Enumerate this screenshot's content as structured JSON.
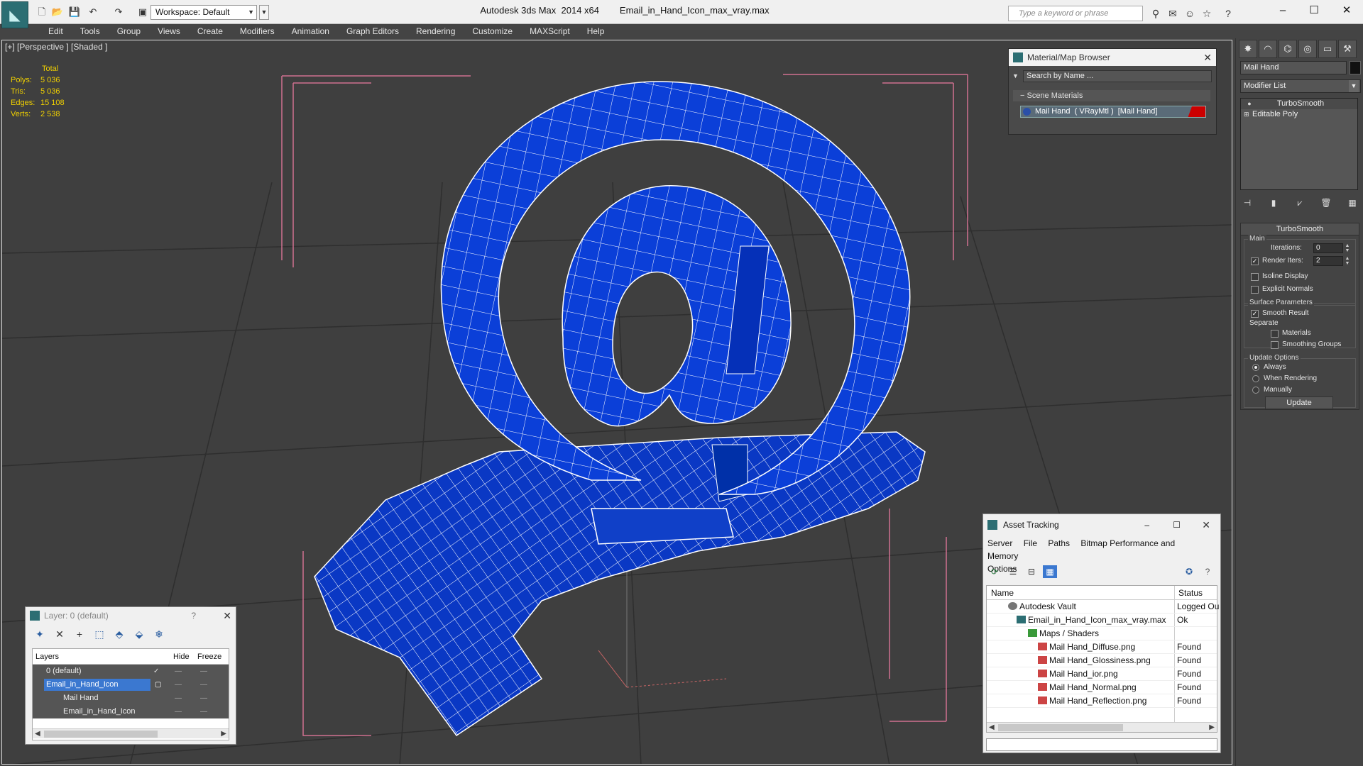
{
  "window": {
    "title": "Autodesk 3ds Max  2014 x64        Email_in_Hand_Icon_max_vray.max",
    "workspace": "Workspace: Default",
    "search_placeholder": "Type a keyword or phrase"
  },
  "menu": [
    "Edit",
    "Tools",
    "Group",
    "Views",
    "Create",
    "Modifiers",
    "Animation",
    "Graph Editors",
    "Rendering",
    "Customize",
    "MAXScript",
    "Help"
  ],
  "viewport": {
    "label": "[+] [Perspective ] [Shaded ]",
    "stats": {
      "header": "Total",
      "rows": [
        {
          "label": "Polys:",
          "value": "5 036"
        },
        {
          "label": "Tris:",
          "value": "5 036"
        },
        {
          "label": "Edges:",
          "value": "15 108"
        },
        {
          "label": "Verts:",
          "value": "2 538"
        }
      ]
    },
    "colors": {
      "mesh": "#0b3fd8",
      "wire": "#ffffff",
      "bbox": "#d07090",
      "grid": "#2f2f2f"
    }
  },
  "command_panel": {
    "object_name": "Mail Hand",
    "modifier_list": "Modifier List",
    "stack": [
      "TurboSmooth",
      "Editable Poly"
    ],
    "rollout": {
      "title": "TurboSmooth",
      "main_label": "Main",
      "iterations_label": "Iterations:",
      "iterations_value": "0",
      "render_iters_label": "Render Iters:",
      "render_iters_value": "2",
      "isoline": "Isoline Display",
      "explicit": "Explicit Normals",
      "surface_label": "Surface Parameters",
      "smooth_result": "Smooth Result",
      "separate_label": "Separate",
      "materials": "Materials",
      "smoothing_groups": "Smoothing Groups",
      "update_label": "Update Options",
      "always": "Always",
      "when_rendering": "When Rendering",
      "manually": "Manually",
      "update_button": "Update"
    }
  },
  "material_browser": {
    "title": "Material/Map Browser",
    "search": "Search by Name ...",
    "section": "Scene Materials",
    "item": "Mail Hand  ( VRayMtl )  [Mail Hand]"
  },
  "layers": {
    "title": "Layer: 0 (default)",
    "help": "?",
    "headers": {
      "name": "Layers",
      "hide": "Hide",
      "freeze": "Freeze"
    },
    "rows": [
      {
        "name": "0 (default)",
        "indent": 0
      },
      {
        "name": "Email_in_Hand_Icon",
        "indent": 0
      },
      {
        "name": "Mail Hand",
        "indent": 1
      },
      {
        "name": "Email_in_Hand_Icon",
        "indent": 1
      }
    ]
  },
  "assets": {
    "title": "Asset Tracking",
    "menu": [
      "Server",
      "File",
      "Paths",
      "Bitmap Performance and Memory",
      "Options"
    ],
    "headers": {
      "name": "Name",
      "status": "Status"
    },
    "rows": [
      {
        "name": "Autodesk Vault",
        "status": "Logged Ou",
        "indent": 0
      },
      {
        "name": "Email_in_Hand_Icon_max_vray.max",
        "status": "Ok",
        "indent": 1
      },
      {
        "name": "Maps / Shaders",
        "status": "",
        "indent": 2
      },
      {
        "name": "Mail Hand_Diffuse.png",
        "status": "Found",
        "indent": 3
      },
      {
        "name": "Mail Hand_Glossiness.png",
        "status": "Found",
        "indent": 3
      },
      {
        "name": "Mail Hand_ior.png",
        "status": "Found",
        "indent": 3
      },
      {
        "name": "Mail Hand_Normal.png",
        "status": "Found",
        "indent": 3
      },
      {
        "name": "Mail Hand_Reflection.png",
        "status": "Found",
        "indent": 3
      }
    ]
  }
}
